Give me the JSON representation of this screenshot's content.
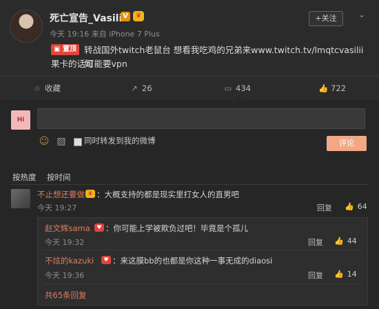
{
  "post": {
    "username": "死亡宣告_Vasilii",
    "verified_badge": "V",
    "meta": "今天 19:16 来自 iPhone 7 Plus",
    "follow_label": "+关注",
    "pinned_label": "置顶",
    "text_line1": "转战国外twitch老鼠台 想看我吃鸡的兄弟来www.twitch.tv/lmqtcvasilii 如",
    "text_line2": "果卡的话可能要vpn"
  },
  "actions": {
    "favorite": "收藏",
    "repost_count": "26",
    "comment_count": "434",
    "like_count": "722"
  },
  "composer": {
    "checkbox_label": "同时转发到我的微博",
    "submit_label": "评论"
  },
  "sort": {
    "by_hot": "按热度",
    "by_time": "按时间"
  },
  "comments": [
    {
      "user": "不止想还要做",
      "text": "：大概支持的都是现实里打女人的直男吧",
      "time": "今天 19:27",
      "reply": "回复",
      "likes": "64",
      "replies": [
        {
          "user": "赵文辉sama",
          "text": "：你可能上学被欺负过吧！毕竟是个孤儿",
          "time": "今天 19:32",
          "reply": "回复",
          "likes": "44"
        },
        {
          "user": "不炫的kazuki",
          "text": "：来这膜bb的也都是你这种一事无成的diaosi",
          "time": "今天 19:36",
          "reply": "回复",
          "likes": "14"
        }
      ],
      "more_replies": "共65条回复"
    }
  ],
  "colors": {
    "background": "#2b2b2b",
    "accent_username": "#e07a5f",
    "submit_button": "#f2a887",
    "pinned_badge": "#e0453c"
  }
}
